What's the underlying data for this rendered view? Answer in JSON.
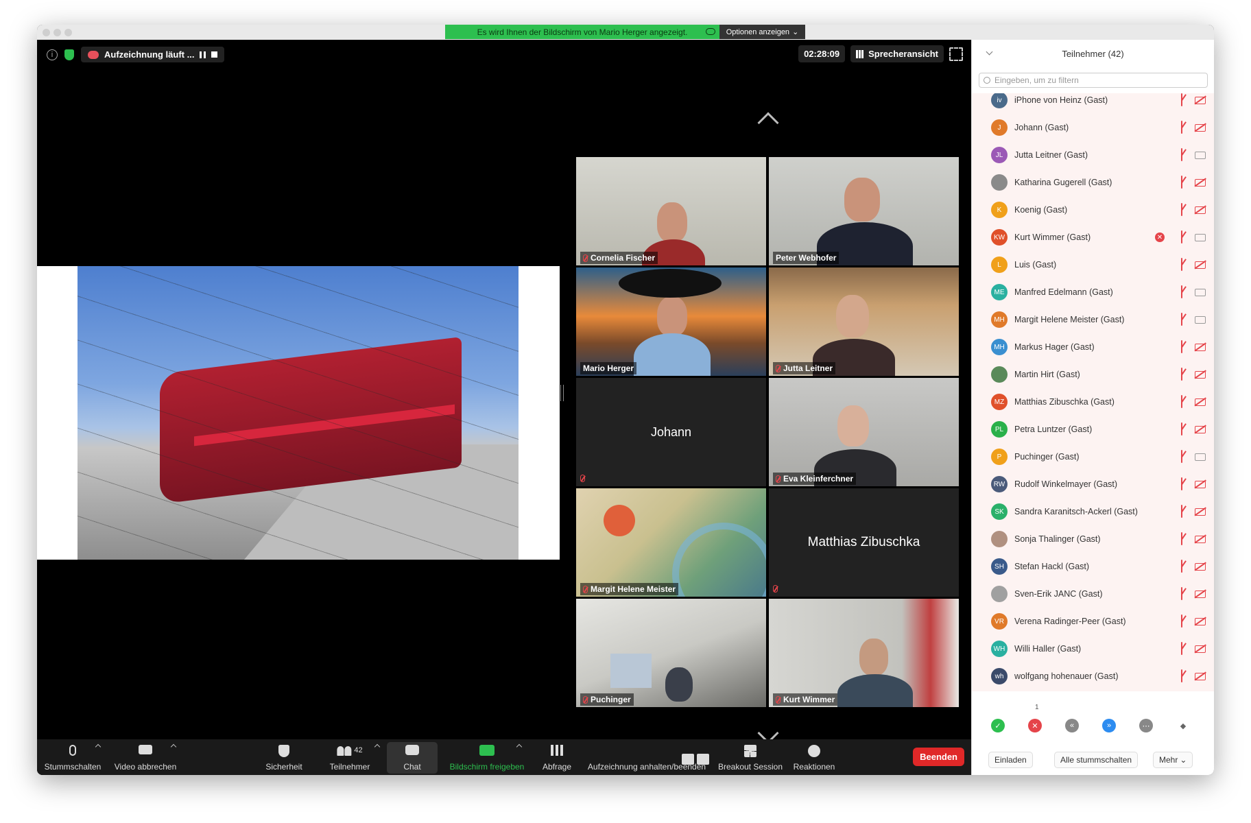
{
  "banner": {
    "text": "Es wird Ihnen der Bildschirm von Mario Herger angezeigt.",
    "options_label": "Optionen anzeigen"
  },
  "topbar": {
    "recording_label": "Aufzeichnung läuft ...",
    "timer": "02:28:09",
    "view_label": "Sprecheransicht"
  },
  "tiles": [
    {
      "name": "Cornelia Fischer",
      "muted": true
    },
    {
      "name": "Peter Webhofer",
      "muted": false
    },
    {
      "name": "Mario Herger",
      "muted": false,
      "active": true
    },
    {
      "name": "Jutta Leitner",
      "muted": true
    },
    {
      "name": "Johann",
      "muted": true,
      "video": false
    },
    {
      "name": "Eva Kleinferchner",
      "muted": true
    },
    {
      "name": "Margit Helene Meister",
      "muted": true
    },
    {
      "name": "Matthias Zibuschka",
      "muted": true,
      "video": false
    },
    {
      "name": "Puchinger",
      "muted": true
    },
    {
      "name": "Kurt Wimmer",
      "muted": true
    }
  ],
  "toolbar": {
    "mute": "Stummschalten",
    "video": "Video abbrechen",
    "security": "Sicherheit",
    "participants": "Teilnehmer",
    "participants_count": "42",
    "chat": "Chat",
    "share": "Bildschirm freigeben",
    "poll": "Abfrage",
    "recording": "Aufzeichnung anhalten/beenden",
    "breakout": "Breakout Session",
    "reactions": "Reaktionen",
    "end": "Beenden"
  },
  "panel": {
    "title": "Teilnehmer (42)",
    "filter_placeholder": "Eingeben, um zu filtern",
    "participants": [
      {
        "initials": "iv",
        "name": "iPhone von Heinz (Gast)",
        "color": "#4a6a8a",
        "cam": "off"
      },
      {
        "initials": "J",
        "name": "Johann (Gast)",
        "color": "#e07a2a",
        "cam": "off"
      },
      {
        "initials": "JL",
        "name": "Jutta Leitner (Gast)",
        "color": "#9b59b6",
        "cam": "on"
      },
      {
        "initials": "",
        "name": "Katharina Gugerell (Gast)",
        "color": "#8a8a8a",
        "cam": "off"
      },
      {
        "initials": "K",
        "name": "Koenig (Gast)",
        "color": "#f0a01a",
        "cam": "off"
      },
      {
        "initials": "KW",
        "name": "Kurt Wimmer (Gast)",
        "color": "#e0502a",
        "cam": "on",
        "hand": true
      },
      {
        "initials": "L",
        "name": "Luis (Gast)",
        "color": "#f0a01a",
        "cam": "off"
      },
      {
        "initials": "ME",
        "name": "Manfred Edelmann (Gast)",
        "color": "#2ab0a0",
        "cam": "on"
      },
      {
        "initials": "MH",
        "name": "Margit Helene Meister (Gast)",
        "color": "#e07a2a",
        "cam": "on"
      },
      {
        "initials": "MH",
        "name": "Markus Hager (Gast)",
        "color": "#3a8fd0",
        "cam": "off"
      },
      {
        "initials": "",
        "name": "Martin Hirt (Gast)",
        "color": "#5a8a5a",
        "cam": "off"
      },
      {
        "initials": "MZ",
        "name": "Matthias Zibuschka (Gast)",
        "color": "#e0502a",
        "cam": "off"
      },
      {
        "initials": "PL",
        "name": "Petra Luntzer (Gast)",
        "color": "#2ab04a",
        "cam": "off"
      },
      {
        "initials": "P",
        "name": "Puchinger (Gast)",
        "color": "#f0a01a",
        "cam": "on"
      },
      {
        "initials": "RW",
        "name": "Rudolf Winkelmayer (Gast)",
        "color": "#4a5a7a",
        "cam": "off"
      },
      {
        "initials": "SK",
        "name": "Sandra Karanitsch-Ackerl (Gast)",
        "color": "#2ab06a",
        "cam": "off"
      },
      {
        "initials": "",
        "name": "Sonja Thalinger (Gast)",
        "color": "#b09080",
        "cam": "off"
      },
      {
        "initials": "SH",
        "name": "Stefan Hackl (Gast)",
        "color": "#3a5a8a",
        "cam": "off"
      },
      {
        "initials": "",
        "name": "Sven-Erik JANC (Gast)",
        "color": "#a0a0a0",
        "cam": "off"
      },
      {
        "initials": "VR",
        "name": "Verena Radinger-Peer (Gast)",
        "color": "#e07a2a",
        "cam": "off"
      },
      {
        "initials": "WH",
        "name": "Willi Haller (Gast)",
        "color": "#2ab0a0",
        "cam": "off"
      },
      {
        "initials": "wh",
        "name": "wolfgang hohenauer (Gast)",
        "color": "#3a4a6a",
        "cam": "off"
      }
    ],
    "no_count": "1",
    "invite": "Einladen",
    "mute_all": "Alle stummschalten",
    "more": "Mehr"
  }
}
